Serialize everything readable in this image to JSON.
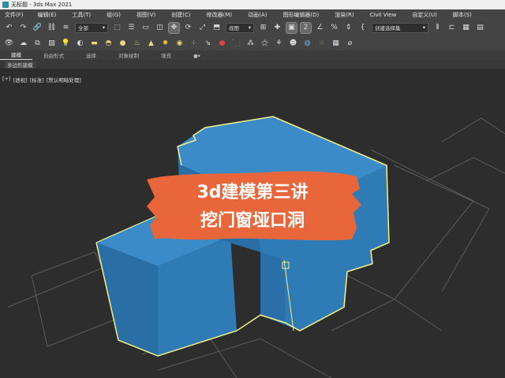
{
  "window": {
    "title": "无标题 - 3ds Max 2021"
  },
  "menu": [
    "文件(F)",
    "编辑(E)",
    "工具(T)",
    "组(G)",
    "视图(V)",
    "创建(C)",
    "修改器(M)",
    "动画(A)",
    "图形编辑器(D)",
    "渲染(R)",
    "Civil View",
    "自定义(U)",
    "脚本(S)"
  ],
  "toolbar": {
    "selection_filter": "全部",
    "ref_coord": "视图",
    "named_selection": "创建选择集"
  },
  "ribbon": {
    "tabs": [
      "建模",
      "自由形式",
      "选择",
      "对象绘制",
      "填充"
    ],
    "sub": "多边形建模"
  },
  "viewport": {
    "labels": [
      "[+]",
      "[透视]",
      "[标准]",
      "[默认明暗处理]"
    ]
  },
  "overlay": {
    "line1": "3d建模第三讲",
    "line2": "挖门窗垭口洞",
    "color": "#e8663a"
  },
  "colors": {
    "object": "#2f7bb5",
    "selection": "#f4f08a",
    "grid": "#5a5a5a"
  }
}
